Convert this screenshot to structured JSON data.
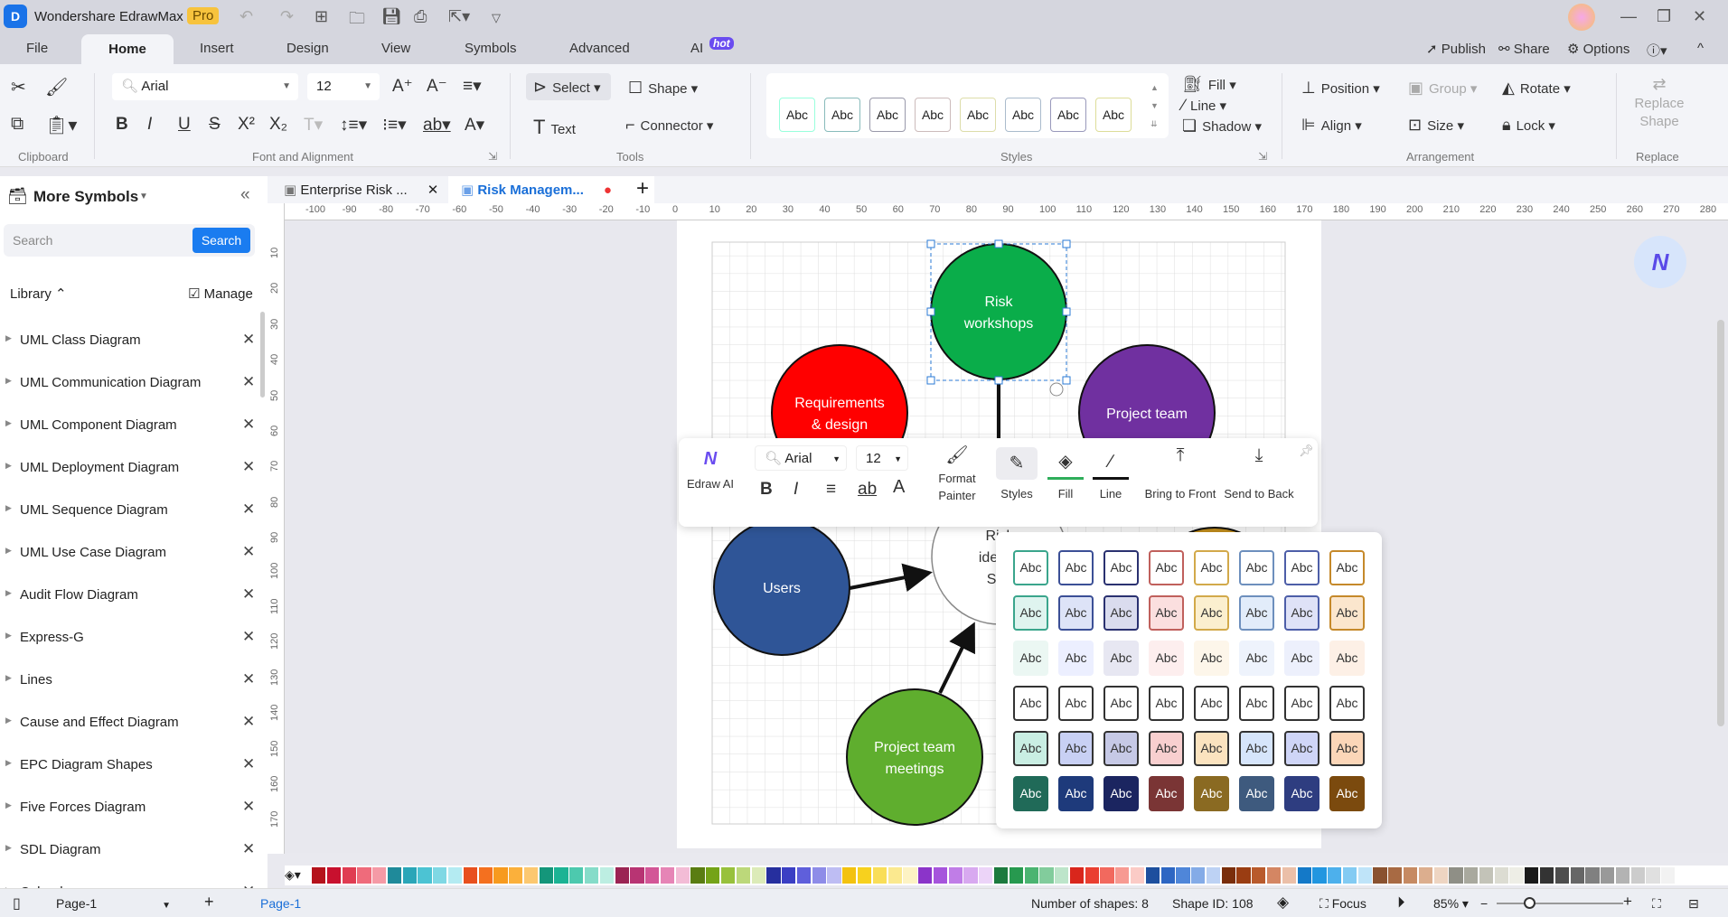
{
  "app": {
    "title": "Wondershare EdrawMax",
    "badge": "Pro"
  },
  "menu": {
    "tabs": [
      "File",
      "Home",
      "Insert",
      "Design",
      "View",
      "Symbols",
      "Advanced",
      "AI"
    ],
    "ai_badge": "hot",
    "right": [
      "Publish",
      "Share",
      "Options"
    ]
  },
  "ribbon": {
    "font": "Arial",
    "size": "12",
    "select": "Select",
    "shape": "Shape",
    "text": "Text",
    "connector": "Connector",
    "style_sample": "Abc",
    "fill": "Fill",
    "line": "Line",
    "shadow": "Shadow",
    "position": "Position",
    "group": "Group",
    "rotate": "Rotate",
    "align": "Align",
    "size_btn": "Size",
    "lock": "Lock",
    "replace": "Replace",
    "replace2": "Shape",
    "groups": [
      "Clipboard",
      "Font and Alignment",
      "Tools",
      "Styles",
      "Arrangement",
      "Replace"
    ]
  },
  "sidebar": {
    "title": "More Symbols",
    "search_placeholder": "Search",
    "search_btn": "Search",
    "library": "Library",
    "manage": "Manage",
    "items": [
      "UML Class Diagram",
      "UML Communication Diagram",
      "UML Component Diagram",
      "UML Deployment Diagram",
      "UML Sequence Diagram",
      "UML Use Case Diagram",
      "Audit Flow Diagram",
      "Express-G",
      "Lines",
      "Cause and Effect Diagram",
      "EPC Diagram Shapes",
      "Five Forces Diagram",
      "SDL Diagram",
      "Calendar"
    ]
  },
  "doc_tabs": [
    {
      "label": "Enterprise Risk ..."
    },
    {
      "label": "Risk Managem..."
    }
  ],
  "ruler": {
    "top": [
      "10",
      "-100",
      "-90",
      "-80",
      "-70",
      "-60",
      "-50",
      "-40",
      "-30",
      "-20",
      "-10",
      "0",
      "10",
      "20",
      "30",
      "40",
      "50",
      "60",
      "70",
      "80",
      "90",
      "100",
      "110",
      "120",
      "130",
      "140",
      "150",
      "160",
      "170",
      "180",
      "190",
      "200",
      "210",
      "220",
      "230",
      "240",
      "250",
      "260",
      "270",
      "280"
    ],
    "left": [
      "10",
      "20",
      "30",
      "40",
      "50",
      "60",
      "70",
      "80",
      "90",
      "100",
      "110",
      "120",
      "130",
      "140",
      "150",
      "160",
      "170"
    ]
  },
  "diagram": {
    "nodes": [
      {
        "id": "risk-workshops",
        "lines": [
          "Risk",
          "workshops"
        ],
        "fill": "#0aad4a",
        "text": "#ffffff"
      },
      {
        "id": "requirements",
        "lines": [
          "Requirements",
          "& design"
        ],
        "fill": "#ff0000",
        "text": "#ffffff"
      },
      {
        "id": "project-team",
        "lines": [
          "Project team"
        ],
        "fill": "#7030a0",
        "text": "#ffffff"
      },
      {
        "id": "users",
        "lines": [
          "Users"
        ],
        "fill": "#2f5597",
        "text": "#ffffff"
      },
      {
        "id": "risk-identification",
        "lines": [
          "Risk",
          "identifi",
          "Sou"
        ],
        "fill": "#ffffff",
        "text": "#333333"
      },
      {
        "id": "project-team-meetings",
        "lines": [
          "Project team",
          "meetings"
        ],
        "fill": "#5fae2e",
        "text": "#ffffff"
      },
      {
        "id": "hidden-node",
        "lines": [],
        "fill": "#c8921e",
        "text": "#ffffff"
      }
    ]
  },
  "floatbar": {
    "edraw_ai": "Edraw AI",
    "font": "Arial",
    "size": "12",
    "format_painter": [
      "Format",
      "Painter"
    ],
    "styles": "Styles",
    "fill": "Fill",
    "line": "Line",
    "bring_front": "Bring to Front",
    "send_back": "Send to Back"
  },
  "style_popup": {
    "sample": "Abc",
    "accents": [
      "#3aa58c",
      "#3b4f96",
      "#2a3170",
      "#c0605c",
      "#d2a94a",
      "#6d8fbd",
      "#4d5ea8",
      "#c5892a"
    ],
    "rows": [
      {
        "fills": [
          "#ffffff",
          "#ffffff",
          "#ffffff",
          "#ffffff",
          "#ffffff",
          "#ffffff",
          "#ffffff",
          "#ffffff"
        ],
        "border": "accent",
        "text": "#333333"
      },
      {
        "fills": [
          "#dff4ef",
          "#dde3f7",
          "#dadcee",
          "#fbdfdf",
          "#fbefcf",
          "#e2ecfa",
          "#dfe2f7",
          "#fbe6cd"
        ],
        "border": "accent",
        "text": "#333333"
      },
      {
        "fills": [
          "#ebf7f3",
          "#ecefff",
          "#e7e7f2",
          "#fdeeee",
          "#fdf6ea",
          "#eef3fc",
          "#edf0fc",
          "#fdf0e6"
        ],
        "border": "none",
        "text": "#333333"
      },
      {
        "fills": [
          "#ffffff",
          "#ffffff",
          "#ffffff",
          "#ffffff",
          "#ffffff",
          "#ffffff",
          "#ffffff",
          "#ffffff"
        ],
        "border": "#333333",
        "text": "#333333"
      },
      {
        "fills": [
          "#c9eee3",
          "#c8d0f4",
          "#c6c9e6",
          "#f8cfcf",
          "#fbe3bf",
          "#d6e5fb",
          "#cfd5f7",
          "#fbd6b8"
        ],
        "border": "#333333",
        "text": "#333333"
      },
      {
        "fills": [
          "#206a58",
          "#1e3a7b",
          "#1b2560",
          "#7a3535",
          "#8a6a22",
          "#3e5a7e",
          "#2e3d80",
          "#7b4a0e"
        ],
        "border": "none",
        "text": "#ffffff"
      }
    ]
  },
  "palette": [
    "#b5121b",
    "#c8102e",
    "#e03c52",
    "#ef6b7b",
    "#f59aa6",
    "#1f8a9a",
    "#2aa6b8",
    "#4cc3d3",
    "#7fd8e4",
    "#b4ebf2",
    "#e8501e",
    "#f4701f",
    "#f79a1e",
    "#fbb03b",
    "#fcc870",
    "#14967a",
    "#1cb394",
    "#4dc9ae",
    "#86dcc9",
    "#bdeee2",
    "#9b2453",
    "#b83473",
    "#d35697",
    "#e685b6",
    "#f3bcd6",
    "#5a7d12",
    "#74a317",
    "#98c13c",
    "#bcd87a",
    "#dcebb8",
    "#262f9e",
    "#3b3fc4",
    "#5f5fdb",
    "#8e8ce8",
    "#bebdf3",
    "#f3c20f",
    "#f7d11e",
    "#f9de58",
    "#fbe98f",
    "#fdf3c4",
    "#8b34c9",
    "#a654dc",
    "#c07de7",
    "#d8a9f0",
    "#ecd4f8",
    "#1c7a3e",
    "#27994f",
    "#4bb471",
    "#82cc9c",
    "#bde5ca",
    "#d9261c",
    "#ea3e30",
    "#f2695e",
    "#f79a92",
    "#fbcbc6",
    "#1d4f9e",
    "#2d66c3",
    "#4f86d9",
    "#84abe7",
    "#bdd2f4",
    "#7a2e0b",
    "#9a3d12",
    "#b95a2c",
    "#d48663",
    "#ebbfa8",
    "#1479c8",
    "#2296e0",
    "#4db0ec",
    "#83cbf3",
    "#bfe4f9",
    "#8a5230",
    "#a86a43",
    "#c68a62",
    "#dcae8e",
    "#eed5c2",
    "#8f8f86",
    "#a9a99e",
    "#c3c3b8",
    "#dcdcd2",
    "#eeeee6",
    "#1a1a1a",
    "#333333",
    "#4d4d4d",
    "#666666",
    "#808080",
    "#999999",
    "#b3b3b3",
    "#cccccc",
    "#e0e0e0",
    "#f2f2f2"
  ],
  "status": {
    "page_select": "Page-1",
    "page_tab": "Page-1",
    "shapes": "Number of shapes: 8",
    "shape_id": "Shape ID: 108",
    "focus": "Focus",
    "zoom": "85%"
  }
}
